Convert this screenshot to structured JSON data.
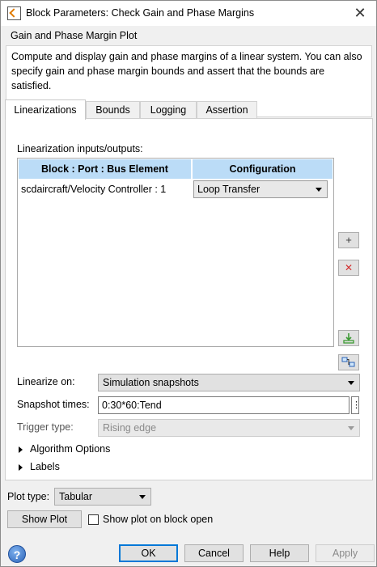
{
  "window": {
    "title": "Block Parameters: Check Gain and Phase Margins",
    "close_glyph": "✕"
  },
  "description": {
    "group_title": "Gain and Phase Margin Plot",
    "text": "Compute and display gain and phase margins of a linear system. You can also specify gain and phase margin bounds and assert that the bounds are satisfied."
  },
  "tabs": [
    {
      "label": "Linearizations",
      "active": true
    },
    {
      "label": "Bounds",
      "active": false
    },
    {
      "label": "Logging",
      "active": false
    },
    {
      "label": "Assertion",
      "active": false
    }
  ],
  "linearizations": {
    "section_label": "Linearization inputs/outputs:",
    "columns": [
      "Block : Port : Bus Element",
      "Configuration"
    ],
    "rows": [
      {
        "block": "scdaircraft/Velocity Controller : 1",
        "configuration": "Loop Transfer"
      }
    ],
    "side_buttons": {
      "add": "+",
      "remove": "✕",
      "add_icon": "import-signals-icon",
      "highlight_icon": "highlight-in-model-icon"
    },
    "linearize_on_label": "Linearize on:",
    "linearize_on_value": "Simulation snapshots",
    "snapshot_times_label": "Snapshot times:",
    "snapshot_times_value": "0:30*60:Tend",
    "snapshot_menu_glyph": "⋮",
    "trigger_type_label": "Trigger type:",
    "trigger_type_value": "Rising edge",
    "algorithm_options_label": "Algorithm Options",
    "labels_label": "Labels"
  },
  "plot": {
    "plot_type_label": "Plot type:",
    "plot_type_value": "Tabular",
    "show_plot_label": "Show Plot",
    "show_on_open_label": "Show plot on block open",
    "show_on_open_checked": false
  },
  "footer": {
    "help_glyph": "?",
    "ok_label": "OK",
    "cancel_label": "Cancel",
    "help_label": "Help",
    "apply_label": "Apply"
  },
  "colors": {
    "table_header": "#bbdcf7",
    "default_button_border": "#0078d7",
    "remove_icon": "#d32f2f",
    "import_icon": "#3c9a34"
  }
}
